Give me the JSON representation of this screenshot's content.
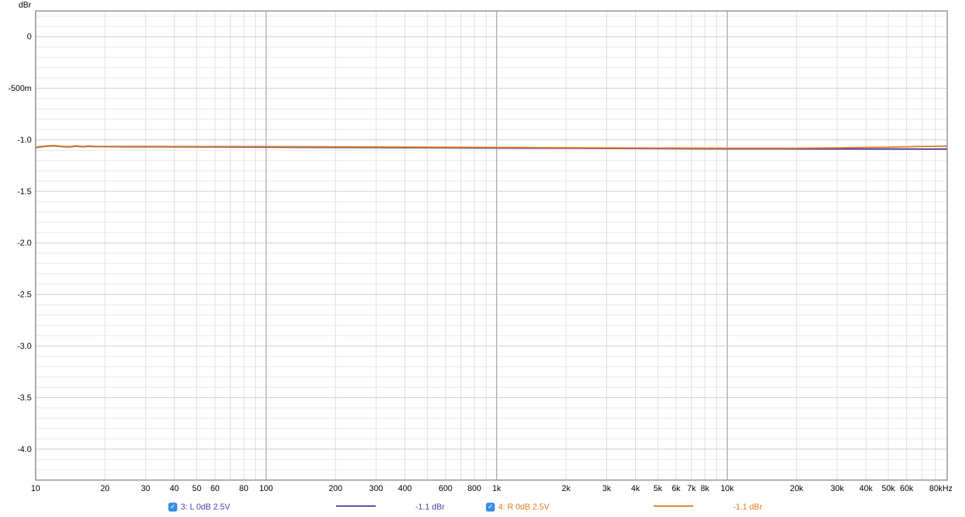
{
  "chart_data": {
    "type": "line",
    "ylabel": "dBr",
    "xscale": "log",
    "xlim": [
      10,
      90000
    ],
    "ylim": [
      -4.3,
      0.25
    ],
    "x_ticks": [
      10,
      20,
      30,
      40,
      50,
      60,
      80,
      100,
      200,
      300,
      400,
      600,
      800,
      1000,
      2000,
      3000,
      4000,
      5000,
      6000,
      7000,
      8000,
      10000,
      20000,
      30000,
      40000,
      50000,
      60000,
      80000
    ],
    "x_tick_labels": [
      "10",
      "20",
      "30",
      "40",
      "50",
      "60",
      "80",
      "100",
      "200",
      "300",
      "400",
      "600",
      "800",
      "1k",
      "2k",
      "3k",
      "4k",
      "5k",
      "6k",
      "7k",
      "8k",
      "10k",
      "20k",
      "30k",
      "40k",
      "50k",
      "60k",
      "80kHz"
    ],
    "y_ticks": [
      0,
      -0.5,
      -1.0,
      -1.5,
      -2.0,
      -2.5,
      -3.0,
      -3.5,
      -4.0
    ],
    "y_tick_labels": [
      "0",
      "-500m",
      "-1.0",
      "-1.5",
      "-2.0",
      "-2.5",
      "-3.0",
      "-3.5",
      "-4.0"
    ],
    "grid": true,
    "series": [
      {
        "name": "3: L 0dB 2.5V",
        "color": "#4b3fa6",
        "reading": "-1.1 dBr",
        "x": [
          10,
          11,
          12,
          13,
          14,
          15,
          16,
          17,
          18,
          20,
          25,
          30,
          40,
          50,
          70,
          100,
          200,
          500,
          1000,
          2000,
          5000,
          10000,
          20000,
          50000,
          90000
        ],
        "y": [
          -1.075,
          -1.063,
          -1.058,
          -1.066,
          -1.069,
          -1.061,
          -1.067,
          -1.063,
          -1.066,
          -1.066,
          -1.067,
          -1.067,
          -1.068,
          -1.069,
          -1.07,
          -1.072,
          -1.074,
          -1.077,
          -1.08,
          -1.082,
          -1.085,
          -1.087,
          -1.088,
          -1.089,
          -1.09
        ]
      },
      {
        "name": "4: R 0dB 2.5V",
        "color": "#e07a1a",
        "reading": "-1.1 dBr",
        "x": [
          10,
          11,
          12,
          13,
          14,
          15,
          16,
          17,
          18,
          20,
          25,
          30,
          40,
          50,
          70,
          100,
          200,
          500,
          1000,
          2000,
          5000,
          10000,
          20000,
          30000,
          50000,
          70000,
          90000
        ],
        "y": [
          -1.072,
          -1.06,
          -1.055,
          -1.063,
          -1.066,
          -1.058,
          -1.064,
          -1.06,
          -1.063,
          -1.063,
          -1.064,
          -1.064,
          -1.065,
          -1.066,
          -1.066,
          -1.066,
          -1.068,
          -1.071,
          -1.074,
          -1.077,
          -1.08,
          -1.082,
          -1.082,
          -1.078,
          -1.071,
          -1.064,
          -1.062
        ]
      }
    ]
  }
}
